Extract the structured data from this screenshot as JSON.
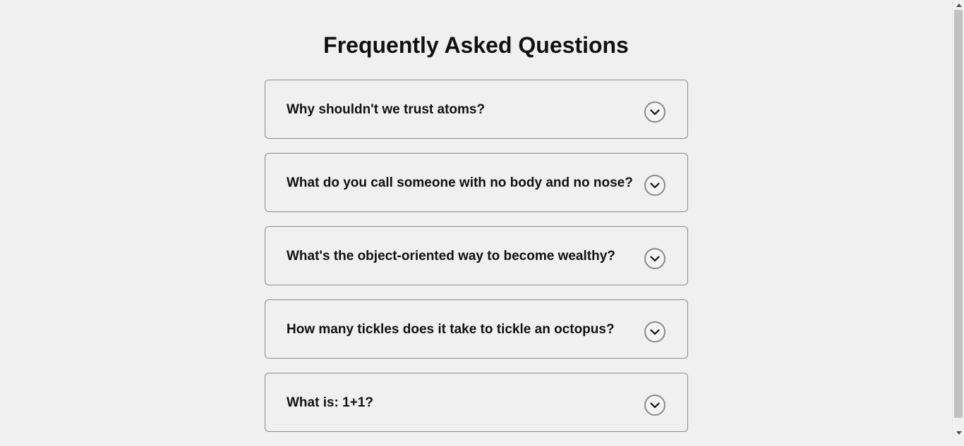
{
  "page": {
    "title": "Frequently Asked Questions"
  },
  "faq": {
    "items": [
      {
        "question": "Why shouldn't we trust atoms?",
        "toggle_icon": "chevron-down-icon"
      },
      {
        "question": "What do you call someone with no body and no nose?",
        "toggle_icon": "chevron-down-icon"
      },
      {
        "question": "What's the object-oriented way to become wealthy?",
        "toggle_icon": "chevron-down-icon"
      },
      {
        "question": "How many tickles does it take to tickle an octopus?",
        "toggle_icon": "chevron-down-icon"
      },
      {
        "question": "What is: 1+1?",
        "toggle_icon": "chevron-down-icon"
      }
    ]
  },
  "colors": {
    "background": "#f0f0f0",
    "border": "#8c8c8c",
    "text": "#111111",
    "toggle_border": "#8a8a8a"
  },
  "scrollbar": {
    "up_icon": "scroll-up-arrow-icon",
    "down_icon": "scroll-down-arrow-icon"
  }
}
